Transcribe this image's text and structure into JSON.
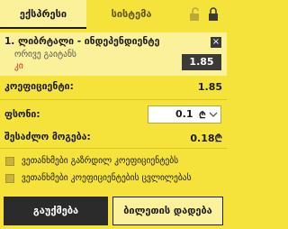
{
  "tabs": {
    "single": "ექსპრესი",
    "system": "სისტემა"
  },
  "bet": {
    "title": "1. ლიბრტალი - ინდეპენდიენტე",
    "market": "ორივე გაიტანს",
    "pick": "კი",
    "odd": "1.85",
    "close_symbol": "×"
  },
  "summary": {
    "coef_label": "კოეფიციენტი:",
    "coef_value": "1.85",
    "stake_label": "ფსონი:",
    "stake_value": "0.1",
    "currency": "₾",
    "win_label": "შესაძლო მოგება:",
    "win_value": "0.18₾"
  },
  "options": [
    {
      "label": "ვეთანხმები გაზრდილ კოეფიციენტებს"
    },
    {
      "label": "ვეთანხმები კოეფიციენტების ცვლილებას"
    }
  ],
  "buttons": {
    "cancel": "გაუქმება",
    "place": "ბილეთის დადება"
  },
  "icons": {
    "unlock": "unlock-icon",
    "lock": "lock-icon",
    "close": "close-icon",
    "chevron": "chevron-down-icon"
  },
  "colors": {
    "background": "#f5e23a",
    "panel": "#fbf19a",
    "dark": "#2b2b2b",
    "pick": "#d4241c"
  }
}
